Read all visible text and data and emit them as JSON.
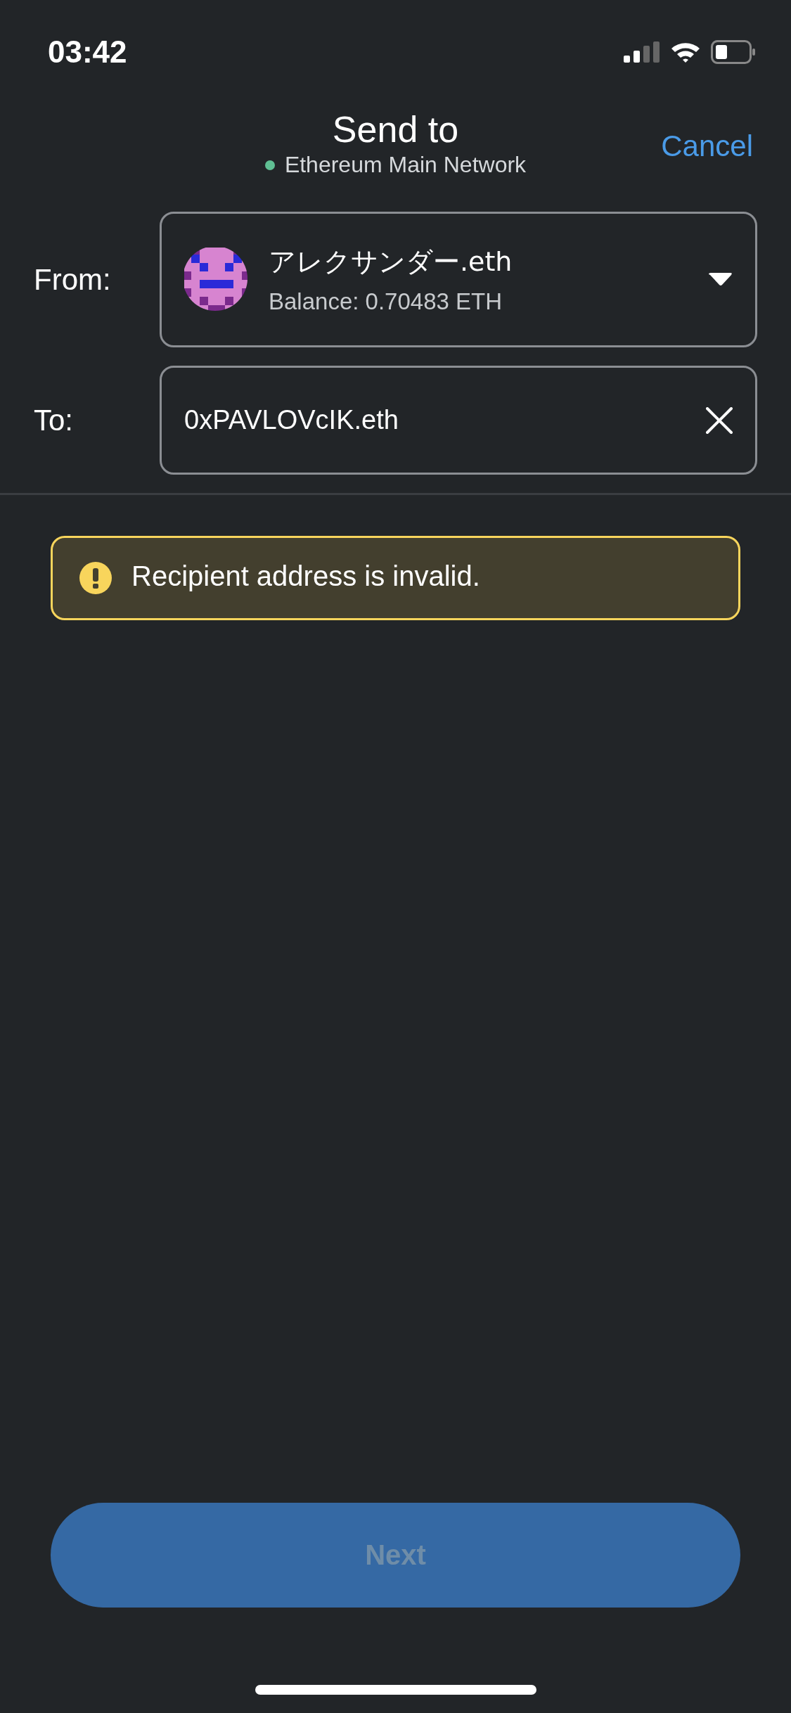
{
  "status_bar": {
    "time": "03:42"
  },
  "header": {
    "title": "Send to",
    "network": "Ethereum Main Network",
    "cancel": "Cancel"
  },
  "from": {
    "label": "From:",
    "account": "アレクサンダー.eth",
    "balance": "Balance: 0.70483 ETH"
  },
  "to": {
    "label": "To:",
    "value": "0xPAVLOVcIK.eth"
  },
  "alert": {
    "kind": "warning",
    "message": "Recipient address is invalid."
  },
  "next_button": {
    "label": "Next",
    "disabled": true
  }
}
